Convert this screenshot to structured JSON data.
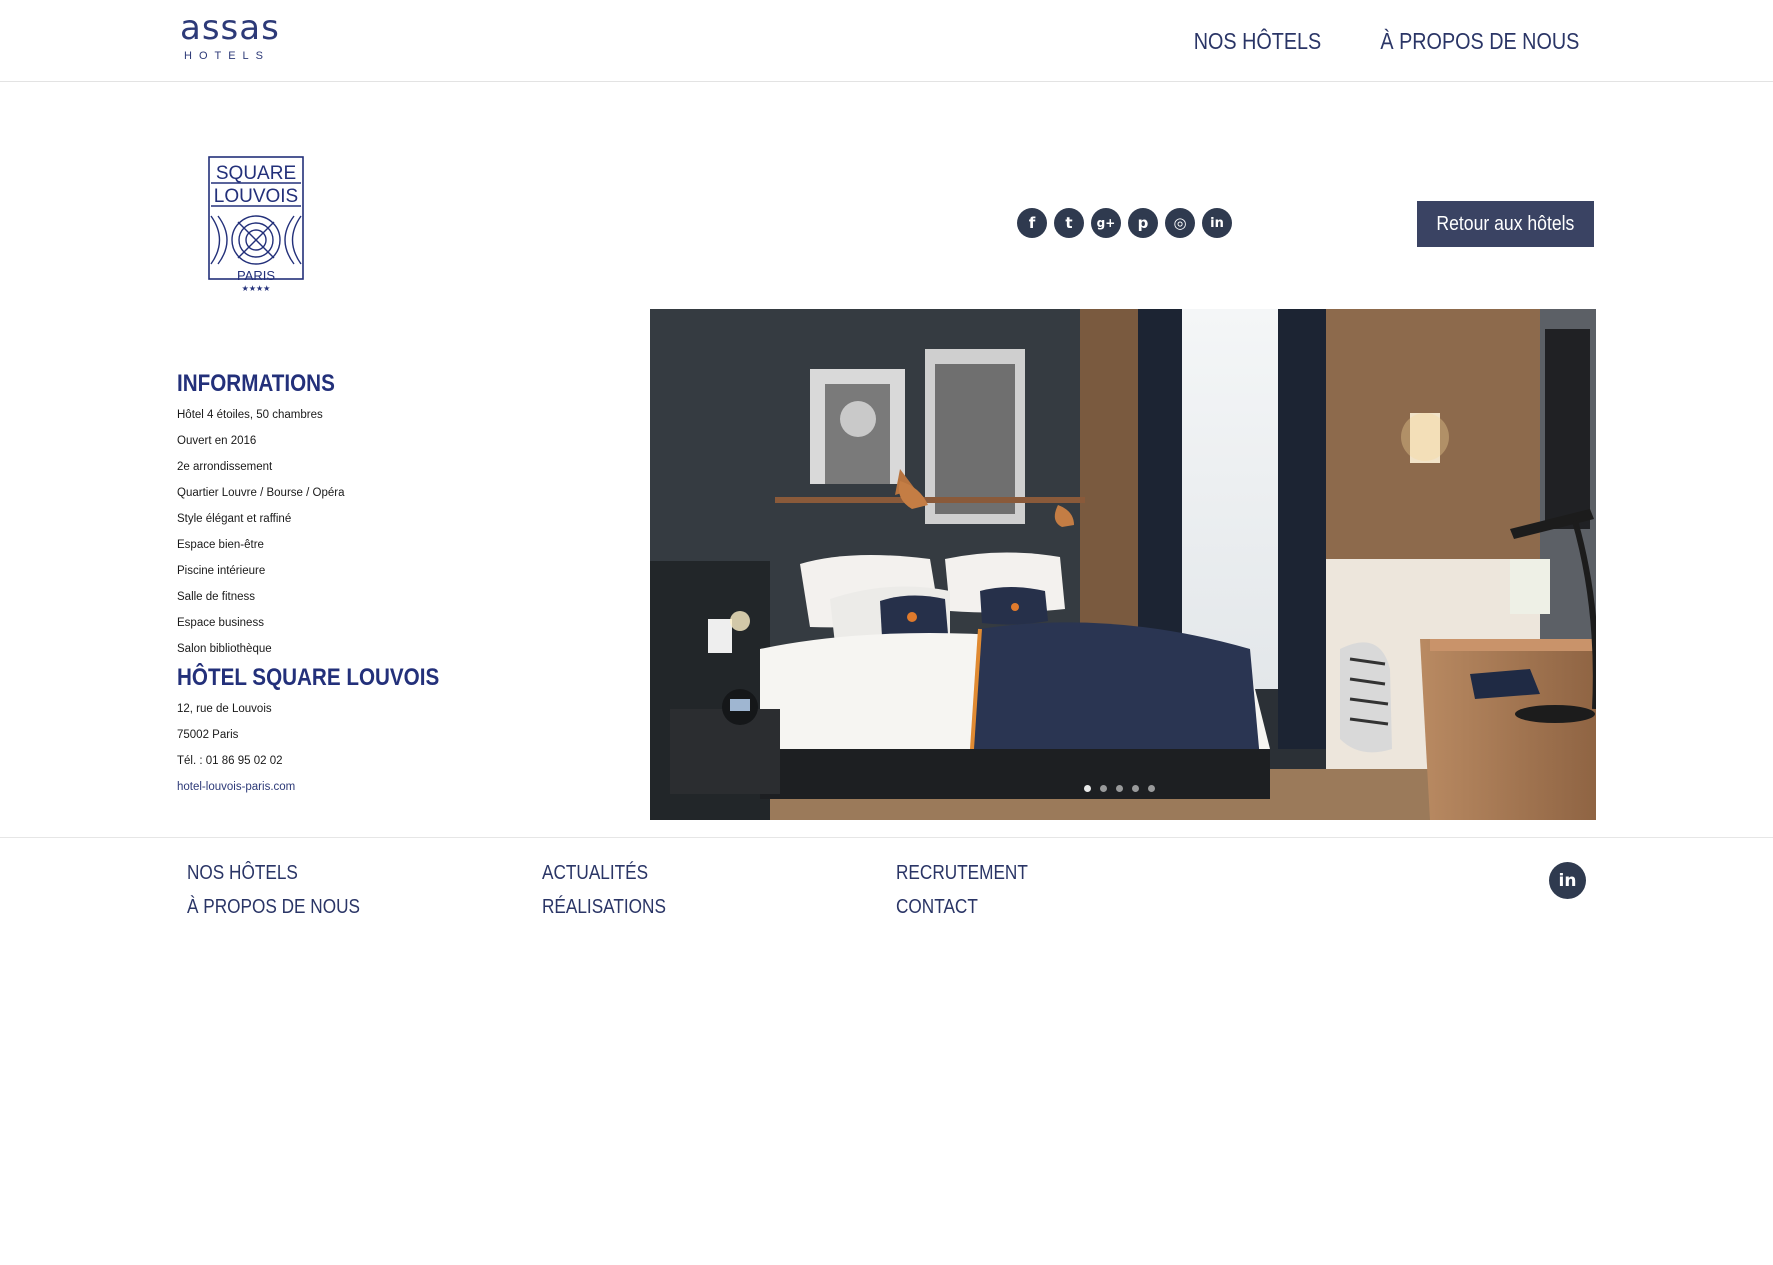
{
  "header": {
    "logo_word": "assas",
    "logo_sub": "HOTELS",
    "nav": [
      "NOS HÔTELS",
      "À PROPOS DE NOUS"
    ]
  },
  "hotel_logo": {
    "lines": [
      "SQUARE",
      "LOUVOIS"
    ],
    "city": "PARIS",
    "stars": "★★★★"
  },
  "social_icons": [
    {
      "name": "facebook-icon",
      "glyph": "f"
    },
    {
      "name": "twitter-icon",
      "glyph": "t"
    },
    {
      "name": "google-plus-icon",
      "glyph": "g+"
    },
    {
      "name": "pinterest-icon",
      "glyph": "p"
    },
    {
      "name": "instagram-icon",
      "glyph": "◎"
    },
    {
      "name": "linkedin-icon",
      "glyph": "in"
    }
  ],
  "back_button": "Retour aux hôtels",
  "info": {
    "title": "INFORMATIONS",
    "items": [
      "Hôtel 4 étoiles, 50 chambres",
      "Ouvert en 2016",
      "2e arrondissement",
      "Quartier Louvre / Bourse / Opéra",
      "Style élégant et raffiné",
      "Espace bien-être",
      "Piscine intérieure",
      "Salle de fitness",
      "Espace business",
      "Salon bibliothèque"
    ]
  },
  "address": {
    "title": "HÔTEL SQUARE LOUVOIS",
    "street": "12, rue de Louvois",
    "city": "75002 Paris",
    "phone": "Tél. : 01 86 95 02 02",
    "website": "hotel-louvois-paris.com"
  },
  "slider": {
    "dot_count": 5,
    "active_index": 0
  },
  "footer": {
    "col1": [
      "NOS HÔTELS",
      "À PROPOS DE NOUS"
    ],
    "col2": [
      "ACTUALITÉS",
      "RÉALISATIONS"
    ],
    "col3": [
      "RECRUTEMENT",
      "CONTACT"
    ],
    "linkedin_glyph": "in"
  },
  "colors": {
    "brand_navy": "#23307a",
    "button_bg": "#3a4363",
    "icon_bg": "#2f3a4f"
  }
}
